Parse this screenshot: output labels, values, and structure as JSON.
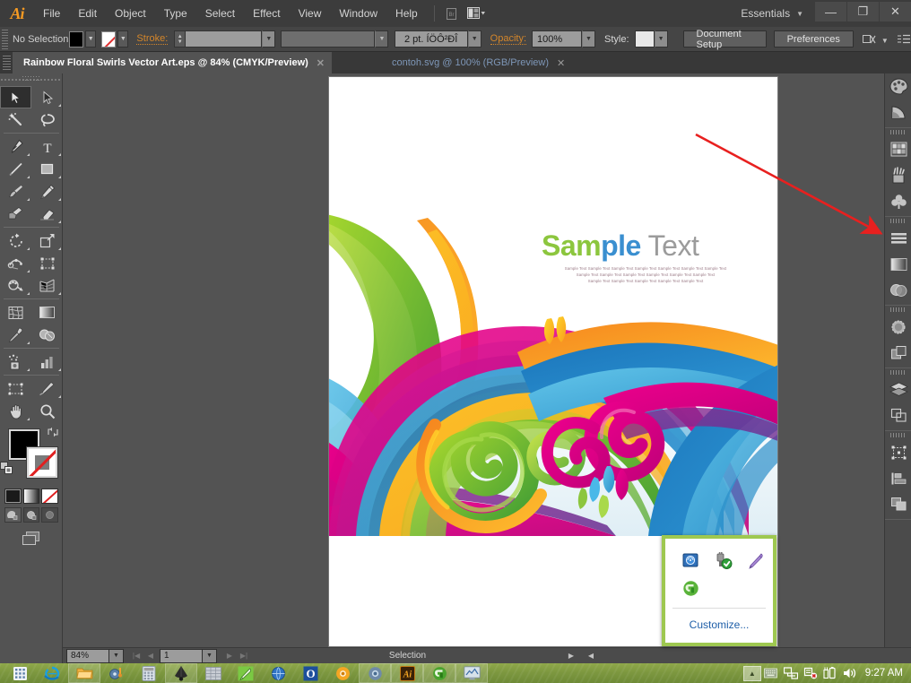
{
  "app": {
    "name": "Adobe Illustrator",
    "logo": "Ai",
    "workspace": "Essentials",
    "window_controls": {
      "minimize": "—",
      "restore": "❐",
      "close": "✕"
    }
  },
  "menubar": {
    "items": [
      {
        "label": "File"
      },
      {
        "label": "Edit"
      },
      {
        "label": "Object"
      },
      {
        "label": "Type"
      },
      {
        "label": "Select"
      },
      {
        "label": "Effect"
      },
      {
        "label": "View"
      },
      {
        "label": "Window"
      },
      {
        "label": "Help"
      }
    ],
    "bridge_icon": "bridge-icon",
    "arrange_icon": "arrange-documents-icon"
  },
  "controlbar": {
    "selection_label": "No Selection",
    "fill_swatch": "#000000",
    "stroke_swatch_none": true,
    "stroke_label": "Stroke:",
    "stroke_weight_value": "",
    "stroke_profile_value": "",
    "brush_definition_value": "2 pt. ÍÖÔ²ÐÎ",
    "opacity_label": "Opacity:",
    "opacity_value": "100%",
    "style_label": "Style:",
    "document_setup_label": "Document Setup",
    "preferences_label": "Preferences",
    "align_icon": "align-to-pixel-grid-icon",
    "panel_menu_icon": "panel-menu-icon"
  },
  "tabs": [
    {
      "title": "Rainbow Floral Swirls Vector Art.eps @ 84%  (CMYK/Preview)",
      "active": true,
      "close": "✕"
    },
    {
      "title": "contoh.svg @ 100% (RGB/Preview)",
      "active": false,
      "close": "✕"
    }
  ],
  "toolbar": {
    "tools": [
      {
        "name": "selection-tool",
        "selected": true,
        "corner": false
      },
      {
        "name": "direct-selection-tool",
        "selected": false,
        "corner": true
      },
      {
        "name": "magic-wand-tool",
        "selected": false,
        "corner": false
      },
      {
        "name": "lasso-tool",
        "selected": false,
        "corner": false
      },
      {
        "name": "pen-tool",
        "selected": false,
        "corner": true
      },
      {
        "name": "type-tool",
        "selected": false,
        "corner": true
      },
      {
        "name": "line-segment-tool",
        "selected": false,
        "corner": true
      },
      {
        "name": "rectangle-tool",
        "selected": false,
        "corner": true
      },
      {
        "name": "paintbrush-tool",
        "selected": false,
        "corner": true
      },
      {
        "name": "pencil-tool",
        "selected": false,
        "corner": true
      },
      {
        "name": "blob-brush-tool",
        "selected": false,
        "corner": false
      },
      {
        "name": "eraser-tool",
        "selected": false,
        "corner": true
      },
      {
        "name": "rotate-tool",
        "selected": false,
        "corner": true
      },
      {
        "name": "scale-tool",
        "selected": false,
        "corner": true
      },
      {
        "name": "width-tool",
        "selected": false,
        "corner": true
      },
      {
        "name": "free-transform-tool",
        "selected": false,
        "corner": false
      },
      {
        "name": "shape-builder-tool",
        "selected": false,
        "corner": true
      },
      {
        "name": "perspective-grid-tool",
        "selected": false,
        "corner": true
      },
      {
        "name": "mesh-tool",
        "selected": false,
        "corner": false
      },
      {
        "name": "gradient-tool",
        "selected": false,
        "corner": false
      },
      {
        "name": "eyedropper-tool",
        "selected": false,
        "corner": true
      },
      {
        "name": "blend-tool",
        "selected": false,
        "corner": false
      },
      {
        "name": "symbol-sprayer-tool",
        "selected": false,
        "corner": true
      },
      {
        "name": "column-graph-tool",
        "selected": false,
        "corner": true
      },
      {
        "name": "artboard-tool",
        "selected": false,
        "corner": false
      },
      {
        "name": "slice-tool",
        "selected": false,
        "corner": true
      },
      {
        "name": "hand-tool",
        "selected": false,
        "corner": true
      },
      {
        "name": "zoom-tool",
        "selected": false,
        "corner": false
      }
    ],
    "fill_color": "#000000",
    "stroke_color": "#ffffff",
    "swap_icon": "swap-fill-stroke-icon",
    "default_icon": "default-fill-stroke-icon",
    "fill_modes": [
      {
        "name": "color-mode",
        "active": true
      },
      {
        "name": "gradient-mode",
        "active": false
      },
      {
        "name": "none-mode",
        "active": false
      }
    ],
    "draw_modes": [
      {
        "name": "draw-normal-mode",
        "active": true
      },
      {
        "name": "draw-behind-mode",
        "active": false
      },
      {
        "name": "draw-inside-mode",
        "active": false
      }
    ],
    "screen_mode": "change-screen-mode-icon"
  },
  "canvas": {
    "artwork_title": "Rainbow Floral Swirls",
    "sample_text": {
      "part1": "Sam",
      "part2": "ple",
      "part3": " Text"
    },
    "sample_lines": [
      "Sample Text Sample Text Sample Text Sample Text Sample Text Sample Text Sample Text",
      "Sample Text Sample Text Sample Text Sample Text Sample Text Sample Text",
      "Sample Text Sample Text Sample Text Sample Text Sample Text"
    ],
    "annotation": {
      "name": "red-arrow-annotation",
      "color": "#e8201f"
    },
    "palette": {
      "green_light": "#8cc63e",
      "green_dark": "#3f9c35",
      "orange": "#f58220",
      "yellow": "#ffc20e",
      "magenta": "#e6007e",
      "purple": "#8e2f8f",
      "blue": "#1b75bb",
      "blue_light": "#4ab8e8",
      "text_green": "#8cc63e",
      "text_blue": "#3a8fd0",
      "text_gray": "#9b9b9b"
    }
  },
  "statusbar": {
    "zoom_value": "84%",
    "zoom_caret": "▼",
    "first_page": "|◀",
    "prev_page": "◀",
    "page_value": "1",
    "page_caret": "▼",
    "next_page": "▶",
    "last_page": "▶|",
    "status_text": "Selection",
    "status_caret": "▶",
    "resize_caret": "◀"
  },
  "right_dock": {
    "groups": [
      {
        "items": [
          {
            "name": "color-panel-icon"
          },
          {
            "name": "color-guide-panel-icon"
          }
        ]
      },
      {
        "items": [
          {
            "name": "swatches-panel-icon"
          },
          {
            "name": "brushes-panel-icon"
          },
          {
            "name": "symbols-panel-icon"
          }
        ]
      },
      {
        "items": [
          {
            "name": "stroke-panel-icon"
          },
          {
            "name": "gradient-panel-icon"
          },
          {
            "name": "transparency-panel-icon"
          }
        ]
      },
      {
        "items": [
          {
            "name": "appearance-panel-icon"
          },
          {
            "name": "graphic-styles-panel-icon"
          }
        ]
      },
      {
        "items": [
          {
            "name": "layers-panel-icon"
          },
          {
            "name": "artboards-panel-icon"
          }
        ]
      },
      {
        "items": [
          {
            "name": "transform-panel-icon"
          },
          {
            "name": "align-panel-icon"
          },
          {
            "name": "pathfinder-panel-icon"
          }
        ]
      }
    ]
  },
  "tray_popup": {
    "icons": [
      {
        "name": "hdd-protection-icon"
      },
      {
        "name": "safely-remove-hardware-icon"
      },
      {
        "name": "wacom-pen-icon"
      },
      {
        "name": "green-app-icon"
      }
    ],
    "customize_label": "Customize...",
    "border_color": "#9ec850"
  },
  "taskbar": {
    "buttons": [
      {
        "name": "start-menu-button",
        "boxed": false
      },
      {
        "name": "internet-explorer-button",
        "boxed": false
      },
      {
        "name": "file-explorer-button",
        "boxed": true
      },
      {
        "name": "media-player-button",
        "boxed": false
      },
      {
        "name": "calculator-button",
        "boxed": false
      },
      {
        "name": "inkscape-button",
        "boxed": true
      },
      {
        "name": "spreadsheet-button",
        "boxed": false
      },
      {
        "name": "paint-button",
        "boxed": false
      },
      {
        "name": "browser-globe-button",
        "boxed": false
      },
      {
        "name": "opera-button",
        "boxed": false
      },
      {
        "name": "chrome-yellow-button",
        "boxed": false
      },
      {
        "name": "chromium-button",
        "boxed": true
      },
      {
        "name": "illustrator-button",
        "boxed": true
      },
      {
        "name": "green-app-button",
        "boxed": true
      },
      {
        "name": "monitor-app-button",
        "boxed": true
      }
    ],
    "tray": {
      "expand": "▲",
      "icons": [
        {
          "name": "tray-keyboard-icon"
        },
        {
          "name": "tray-network-icon"
        },
        {
          "name": "tray-action-center-icon"
        },
        {
          "name": "tray-battery-icon"
        },
        {
          "name": "tray-volume-icon"
        }
      ],
      "clock": "9:27 AM"
    }
  }
}
